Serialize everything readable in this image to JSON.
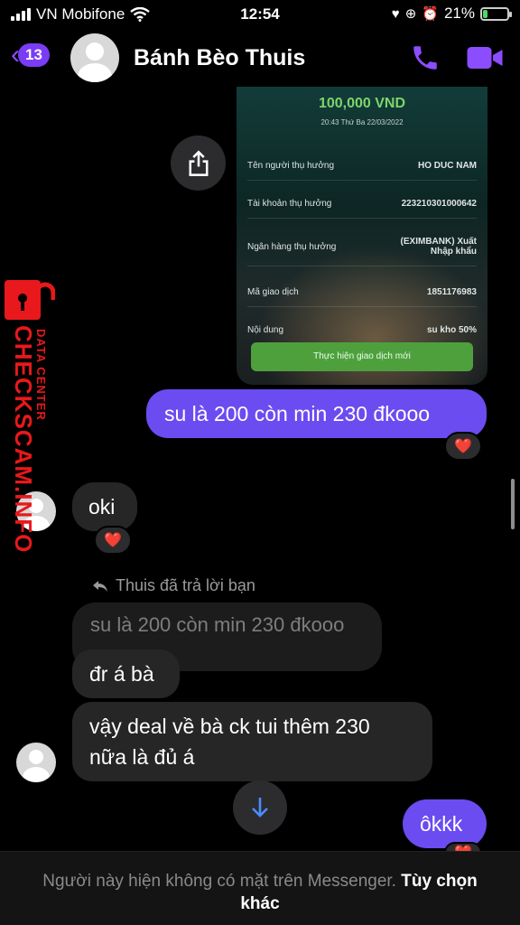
{
  "status_bar": {
    "carrier": "VN Mobifone",
    "time": "12:54",
    "battery": "21%",
    "battery_level": 0.21
  },
  "header": {
    "back_count": "13",
    "contact_name": "Bánh Bèo Thuis"
  },
  "receipt": {
    "amount": "100,000 VND",
    "datetime": "20:43 Thứ Ba 22/03/2022",
    "rows": [
      {
        "label": "Tên người thụ hưởng",
        "value": "HO DUC NAM"
      },
      {
        "label": "Tài khoản thụ hưởng",
        "value": "223210301000642"
      },
      {
        "label": "Ngân hàng thụ hưởng",
        "value": "(EXIMBANK) Xuất Nhập khẩu"
      },
      {
        "label": "Mã giao dịch",
        "value": "1851176983"
      },
      {
        "label": "Nội dung",
        "value": "su kho 50%"
      }
    ],
    "button": "Thực hiện giao dịch mới"
  },
  "messages": {
    "m1": "su là 200 còn min 230 đkooo",
    "m2": "oki",
    "reply_note": "Thuis đã trả lời bạn",
    "quoted": "su là 200 còn min 230 đkooo",
    "m3": "đr á bà",
    "m4_line1": "vậy deal về bà ck tui thêm 230",
    "m4_line2": "nữa là đủ á",
    "m5": "ôkkk"
  },
  "reaction": "❤️",
  "footer": {
    "note": "Người này hiện không có mặt trên Messenger.",
    "more": "Tùy chọn khác"
  },
  "watermark": {
    "word": "CHECKSCAM.INFO",
    "sub": "DATA CENTER"
  },
  "colors": {
    "accent": "#8c4dff",
    "outgoing_bubble": "#6b4cf0",
    "incoming_bubble": "#262626",
    "watermark": "#e8181c"
  }
}
